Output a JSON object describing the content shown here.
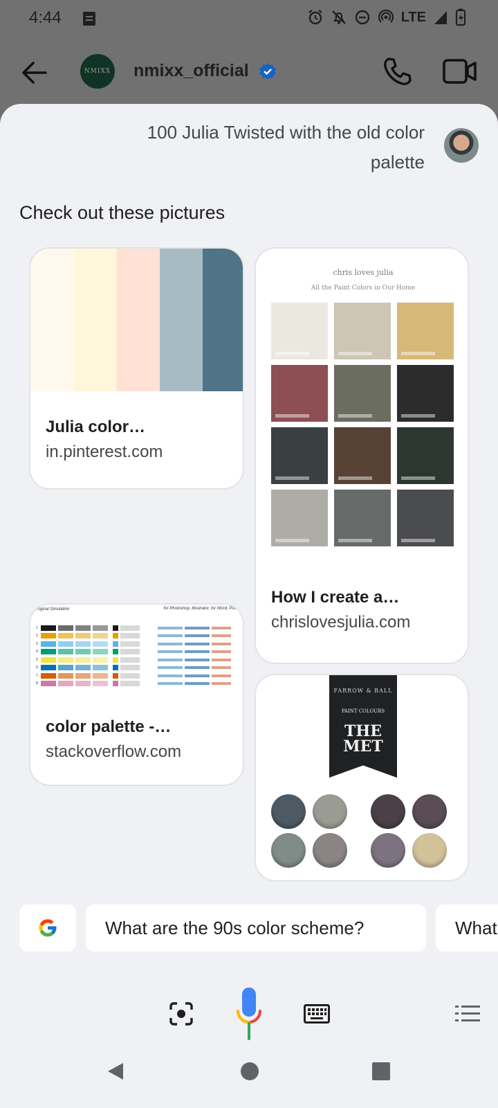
{
  "status": {
    "time": "4:44",
    "network": "LTE"
  },
  "chat_header": {
    "avatar_text": "NMIXX",
    "name": "nmixx_official"
  },
  "assistant": {
    "user_query": "100 Julia Twisted with the old color palette",
    "section_title": "Check out these pictures",
    "cards": [
      {
        "title": "Julia color…",
        "source": "in.pinterest.com",
        "swatch_colors": [
          "#fff8ec",
          "#fff7da",
          "#ffe2d5",
          "#a7bbc5",
          "#4f7387"
        ]
      },
      {
        "title": "How I create a…",
        "source": "chrislovesjulia.com",
        "image_header": "chris loves julia",
        "image_subheader": "All the Paint Colors in Our Home",
        "chip_colors": [
          "#ebe9df",
          "#cdc6b5",
          "#d6b878",
          "#8e4f54",
          "#6c6d61",
          "#2c2c2d",
          "#3a3f40",
          "#574235",
          "#2c3731",
          "#aeaca6",
          "#666a68",
          "#4b4c4f"
        ]
      },
      {
        "title": "color palette -…",
        "source": "stackoverflow.com",
        "image_header_left": "Original  Simulation",
        "image_header_right": "for Photoshop, Illustrator, for Word, Pow…",
        "row_colors": [
          "#1a1a1a",
          "#e69f00",
          "#56b4e9",
          "#009e73",
          "#f0e442",
          "#0072b2",
          "#d55e00",
          "#cc79a7"
        ]
      },
      {
        "image_banner_brand": "FARROW & BALL",
        "image_banner_sub": "PAINT COLOURS",
        "image_banner_title": "THE MET",
        "dot_colors": [
          "#4d5a64",
          "#9a9c94",
          "#4b4048",
          "#5a4d56",
          "#7f8c88",
          "#8a8584",
          "#7d7380",
          "#d2c29a"
        ]
      }
    ],
    "suggestions": [
      "What are the 90s color scheme?",
      "What"
    ]
  }
}
